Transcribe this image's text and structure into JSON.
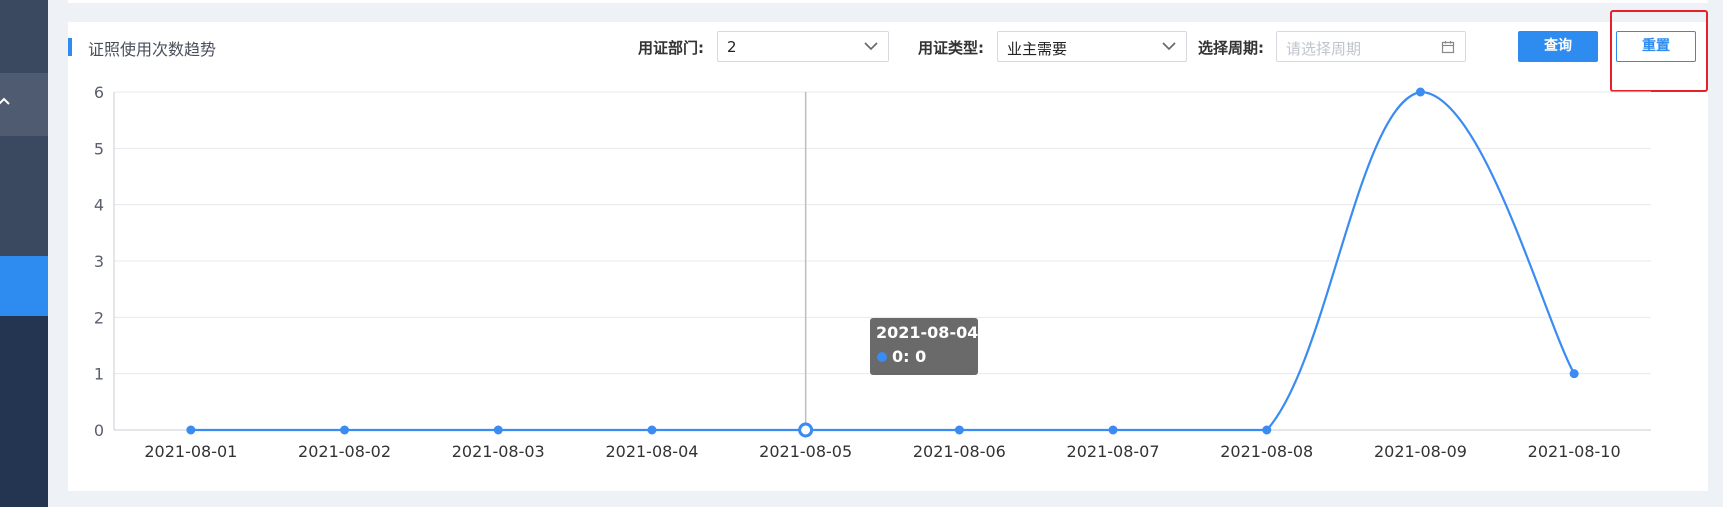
{
  "panel": {
    "title": "证照使用次数趋势"
  },
  "filters": {
    "dept_label": "用证部门:",
    "dept_value": "2",
    "type_label": "用证类型:",
    "type_value": "业主需要",
    "period_label": "选择周期:",
    "period_placeholder": "请选择周期"
  },
  "buttons": {
    "query": "查询",
    "reset": "重置"
  },
  "tooltip": {
    "date": "2021-08-04",
    "value_text": "0: 0"
  },
  "colors": {
    "accent": "#2e8cf0",
    "line": "#3a8bf2",
    "highlight": "#e8202a"
  },
  "chart_data": {
    "type": "line",
    "title": "证照使用次数趋势",
    "categories": [
      "2021-08-01",
      "2021-08-02",
      "2021-08-03",
      "2021-08-04",
      "2021-08-05",
      "2021-08-06",
      "2021-08-07",
      "2021-08-08",
      "2021-08-09",
      "2021-08-10"
    ],
    "series": [
      {
        "values": [
          0,
          0,
          0,
          0,
          0,
          0,
          0,
          0,
          6,
          1
        ]
      }
    ],
    "ylim": [
      0,
      6
    ],
    "yticks": [
      0,
      1,
      2,
      3,
      4,
      5,
      6
    ],
    "grid": true,
    "smooth": true,
    "hover_index": 4
  }
}
